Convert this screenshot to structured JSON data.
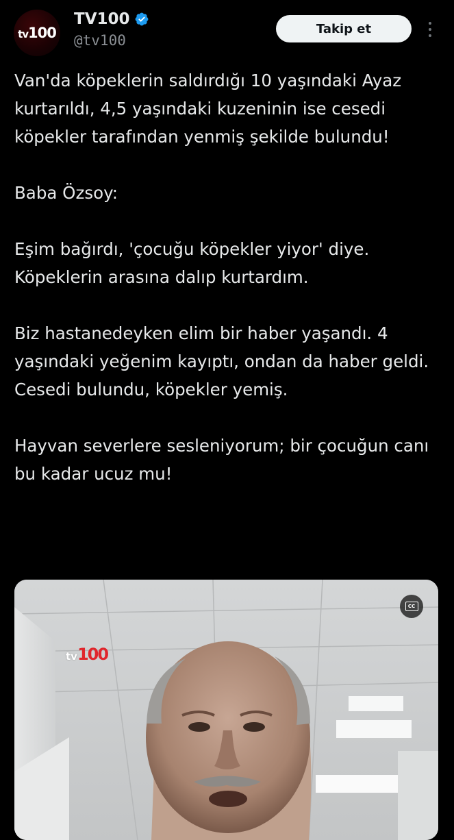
{
  "account": {
    "display_name": "TV100",
    "handle": "@tv100",
    "avatar_logo_prefix": "tv",
    "avatar_logo_number": "100",
    "verified": true
  },
  "actions": {
    "follow_label": "Takip et"
  },
  "tweet": {
    "paragraphs": [
      "Van'da köpeklerin saldırdığı 10 yaşındaki Ayaz kurtarıldı, 4,5 yaşındaki kuzeninin ise cesedi köpekler tarafından yenmiş şekilde bulundu!",
      "Baba Özsoy:",
      "Eşim bağırdı, 'çocuğu köpekler yiyor' diye. Köpeklerin arasına dalıp kurtardım.",
      "Biz hastanedeyken elim bir haber yaşandı. 4 yaşındaki yeğenim kayıptı, ondan da haber geldi. Cesedi bulundu, köpekler yemiş.",
      "Hayvan severlere sesleniyorum; bir çocuğun canı bu kadar ucuz mu!"
    ]
  },
  "media": {
    "type": "video",
    "watermark_prefix": "tv",
    "watermark_number": "100",
    "cc_label": "CC"
  },
  "colors": {
    "background": "#000000",
    "text_primary": "#e7e9ea",
    "text_secondary": "#8b8f94",
    "verified_blue": "#1d9bf0",
    "follow_button_bg": "#eff3f4",
    "brand_red": "#e0262c"
  },
  "icons": {
    "verified": "verified-badge-icon",
    "more": "more-options-icon",
    "captions": "closed-captions-icon"
  }
}
